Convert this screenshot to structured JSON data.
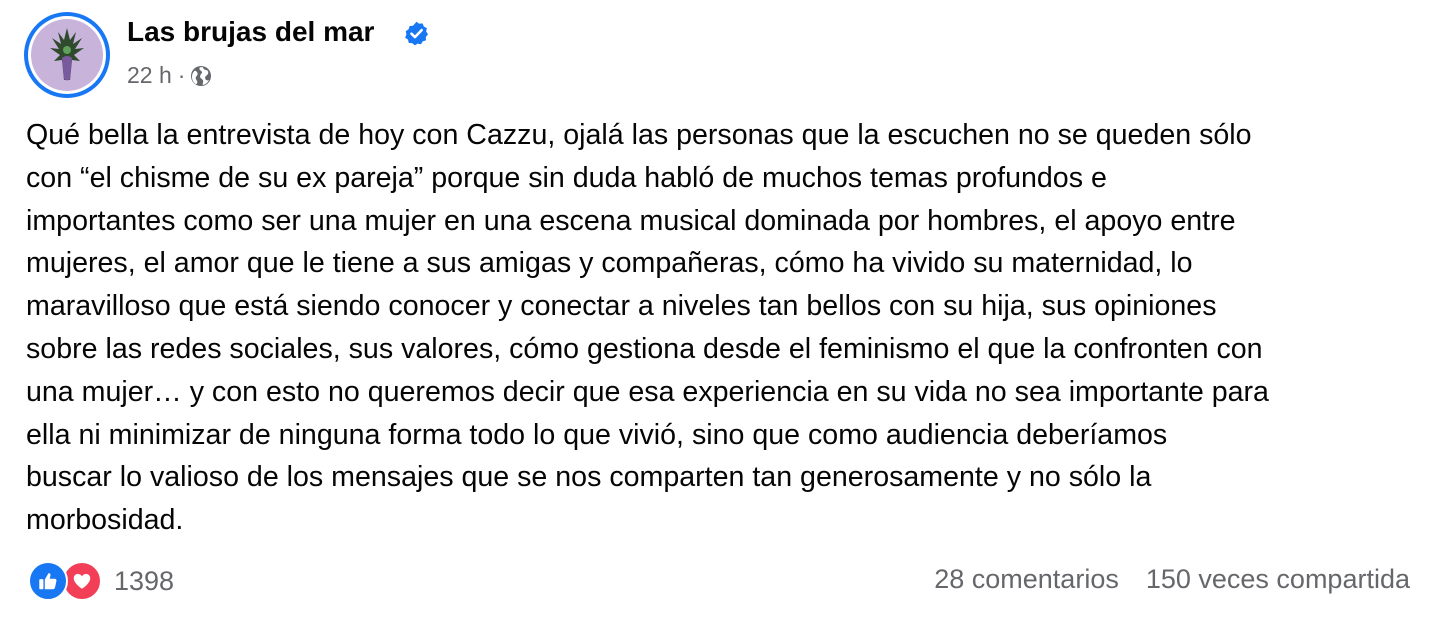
{
  "post": {
    "author": "Las brujas del mar",
    "verified_icon": "verified-badge-icon",
    "time": "22 h",
    "separator": "·",
    "audience_icon": "globe-icon",
    "text_lines": [
      "Qué bella la entrevista de hoy con Cazzu, ojalá las personas que la escuchen no se queden sólo",
      "con “el chisme de su ex pareja” porque sin duda habló de muchos temas profundos e",
      "importantes como ser una mujer en una escena musical dominada por hombres, el apoyo entre",
      "mujeres, el amor que le tiene a sus amigas y compañeras, cómo ha vivido su maternidad, lo",
      "maravilloso que está siendo conocer y conectar a niveles tan bellos con su hija, sus opiniones",
      "sobre las redes sociales, sus valores, cómo gestiona desde el feminismo el que la confronten con",
      "una mujer… y con esto no queremos decir que esa experiencia en su vida no sea importante para",
      "ella ni minimizar de ninguna forma todo lo que vivió, sino que como audiencia deberíamos",
      "buscar lo valioso de los mensajes que se nos comparten tan generosamente y no sólo la",
      "morbosidad."
    ]
  },
  "footer": {
    "reaction_icons": [
      "like-icon",
      "love-icon"
    ],
    "reaction_count": "1398",
    "comments": "28 comentarios",
    "shares": "150 veces compartida"
  },
  "colors": {
    "brand_blue": "#1877f2",
    "love_red": "#f33e58",
    "secondary_text": "#65676b",
    "primary_text": "#050505",
    "avatar_bg": "#c8b3db"
  }
}
